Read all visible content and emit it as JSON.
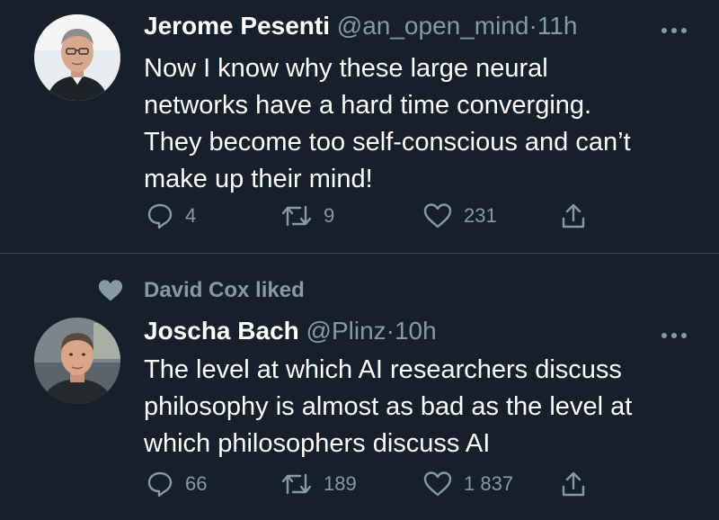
{
  "tweets": [
    {
      "author_name": "Jerome Pesenti",
      "author_handle": "@an_open_mind",
      "separator": "·",
      "time": "11h",
      "text_lines": [
        "Now I know why these large neural",
        "networks have a hard time converging.",
        "They become too self-conscious and can’t",
        "make up their mind!"
      ],
      "stats": {
        "replies": "4",
        "retweets": "9",
        "likes": "231"
      }
    },
    {
      "social_context": "David Cox liked",
      "author_name": "Joscha Bach",
      "author_handle": "@Plinz",
      "separator": "·",
      "time": "10h",
      "text_lines": [
        "The level at which AI researchers discuss",
        "philosophy is almost as bad as the level at",
        "which philosophers discuss AI"
      ],
      "stats": {
        "replies": "66",
        "retweets": "189",
        "likes": "1 837"
      }
    }
  ],
  "icons": {
    "reply": "reply-icon",
    "retweet": "retweet-icon",
    "like": "heart-icon",
    "share": "share-icon",
    "more": "more-icon",
    "liked_context": "heart-filled-icon"
  },
  "colors": {
    "background": "#15202b",
    "primary_text": "#ffffff",
    "secondary_text": "#8899a6",
    "divider": "#38444d"
  }
}
